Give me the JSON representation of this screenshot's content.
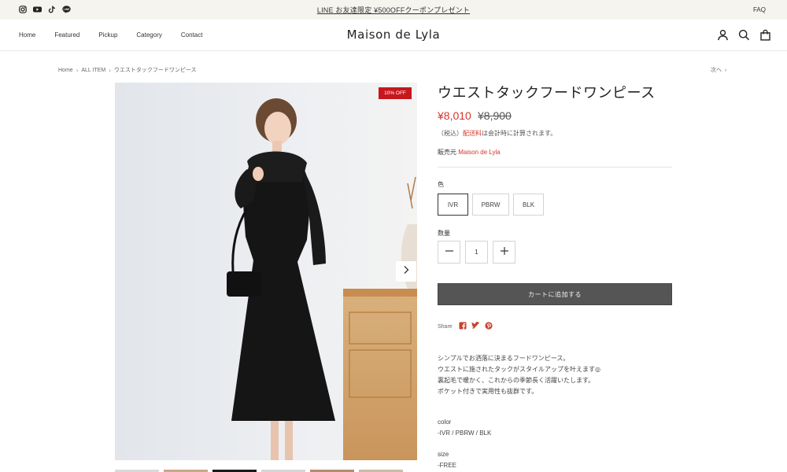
{
  "announcement": {
    "text": "LINE お友達限定 ¥500OFFクーポンプレゼント",
    "faq_label": "FAQ",
    "social_icons": [
      "instagram-icon",
      "youtube-icon",
      "tiktok-icon",
      "line-icon"
    ]
  },
  "header": {
    "logo": "Maison de Lyla",
    "nav": [
      "Home",
      "Featured",
      "Pickup",
      "Category",
      "Contact"
    ],
    "icons": [
      "account-icon",
      "search-icon",
      "cart-icon"
    ]
  },
  "breadcrumb": {
    "items": [
      "Home",
      "ALL ITEM",
      "ウエストタックフードワンピース"
    ],
    "next_label": "次へ"
  },
  "product": {
    "badge": "10% OFF",
    "title": "ウエストタックフードワンピース",
    "price": "¥8,010",
    "compare_price": "¥8,900",
    "tax_prefix": "（税込）",
    "shipping_link": "配送料",
    "tax_suffix": "は会計時に計算されます。",
    "vendor_label": "販売元",
    "vendor_name": "Maison de Lyla",
    "color_label": "色",
    "colors": [
      "IVR",
      "PBRW",
      "BLK"
    ],
    "selected_color": "IVR",
    "quantity_label": "数量",
    "quantity": "1",
    "add_to_cart": "カートに追加する",
    "share_label": "Share",
    "share_icons": [
      "facebook-icon",
      "twitter-icon",
      "pinterest-icon"
    ],
    "description": [
      "シンプルでお洒落に決まるフードワンピース。",
      "ウエストに施されたタックがスタイルアップを叶えます◎",
      "裏起毛で暖かく、これからの季節長く活躍いたします。",
      "ポケット付きで実用性も抜群です。"
    ],
    "spec_color_label": "color",
    "spec_color_value": "-IVR / PBRW / BLK",
    "spec_size_label": "size",
    "spec_size_value": "-FREE"
  },
  "colors": {
    "accent_red": "#d6342b",
    "badge_red": "#c8161d",
    "cart_button": "#555555",
    "announcement_bg": "#f6f4ef"
  }
}
